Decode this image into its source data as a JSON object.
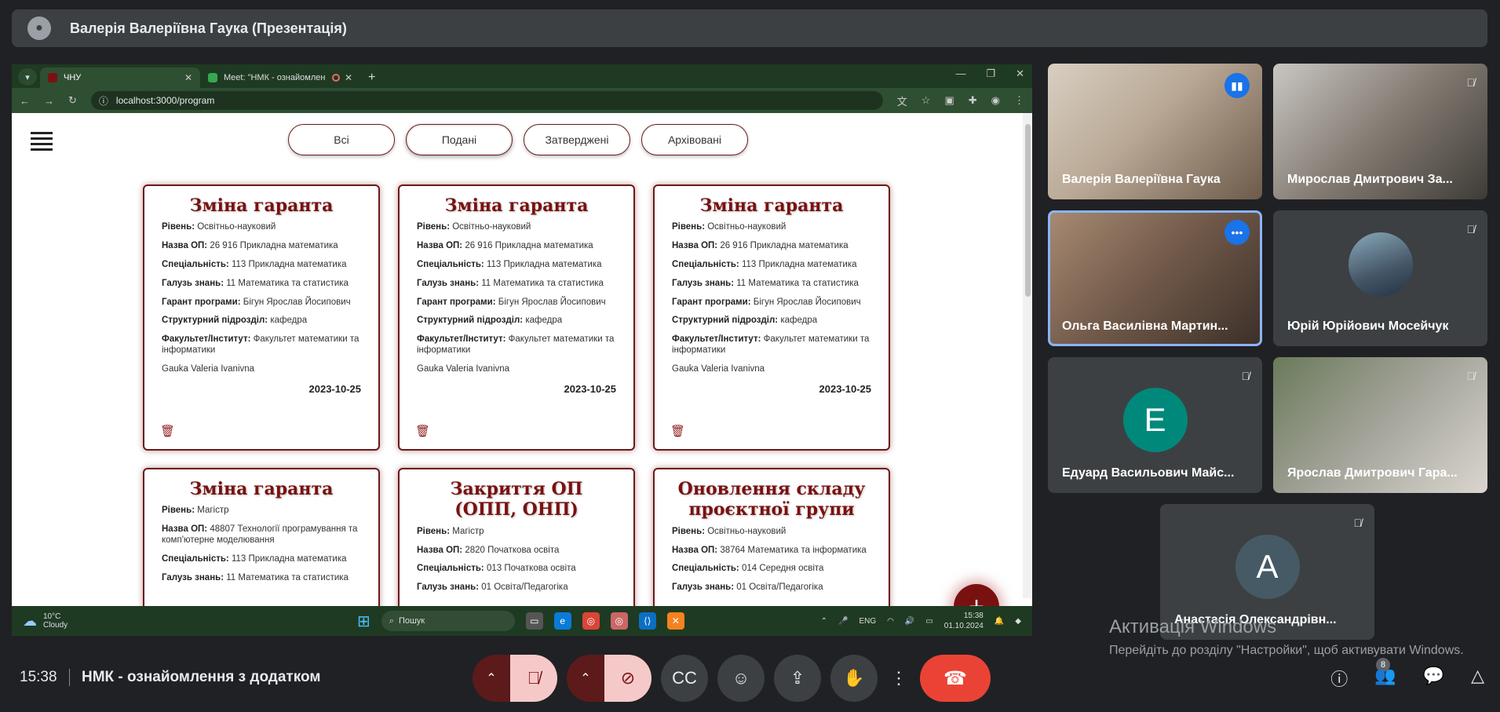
{
  "top": {
    "presenter_title": "Валерія Валеріївна Гаука (Презентація)"
  },
  "browser": {
    "tabs": [
      {
        "title": "ЧНУ"
      },
      {
        "title": "Meet: \"НМК - ознайомлен"
      }
    ],
    "url": "localhost:3000/program"
  },
  "filters": [
    "Всі",
    "Подані",
    "Затверджені",
    "Архівовані"
  ],
  "labels": {
    "level": "Рівень:",
    "op_name": "Назва ОП:",
    "specialty": "Спеціальність:",
    "field": "Галузь знань:",
    "guarantor": "Гарант програми:",
    "unit": "Структурний підрозділ:",
    "faculty": "Факультет/Інститут:"
  },
  "cards": [
    {
      "title": "Зміна гаранта",
      "level": "Освітньо-науковий",
      "op_name": "26 916 Прикладна математика",
      "specialty": "113 Прикладна математика",
      "field": "11 Математика та статистика",
      "guarantor": "Бігун Ярослав Йосипович",
      "unit": "кафедра",
      "faculty": "Факультет математики та інформатики",
      "author": "Gauka Valeria Ivanivna",
      "date": "2023-10-25"
    },
    {
      "title": "Зміна гаранта",
      "level": "Освітньо-науковий",
      "op_name": "26 916 Прикладна математика",
      "specialty": "113 Прикладна математика",
      "field": "11 Математика та статистика",
      "guarantor": "Бігун Ярослав Йосипович",
      "unit": "кафедра",
      "faculty": "Факультет математики та інформатики",
      "author": "Gauka Valeria Ivanivna",
      "date": "2023-10-25"
    },
    {
      "title": "Зміна гаранта",
      "level": "Освітньо-науковий",
      "op_name": "26 916 Прикладна математика",
      "specialty": "113 Прикладна математика",
      "field": "11 Математика та статистика",
      "guarantor": "Бігун Ярослав Йосипович",
      "unit": "кафедра",
      "faculty": "Факультет математики та інформатики",
      "author": "Gauka Valeria Ivanivna",
      "date": "2023-10-25"
    },
    {
      "title": "Зміна гаранта",
      "level": "Магістр",
      "op_name": "48807 Технології програмування та комп'ютерне моделювання",
      "specialty": "113 Прикладна математика",
      "field": "11 Математика та статистика"
    },
    {
      "title": "Закриття ОП (ОПП, ОНП)",
      "level": "Магістр",
      "op_name": "2820 Початкова освіта",
      "specialty": "013 Початкова освіта",
      "field": "01 Освіта/Педагогіка"
    },
    {
      "title": "Оновлення складу проєктної групи",
      "level": "Освітньо-науковий",
      "op_name": "38764 Математика та інформатика",
      "specialty": "014 Середня освіта",
      "field": "01 Освіта/Педагогіка"
    }
  ],
  "taskbar": {
    "temp": "10°C",
    "condition": "Cloudy",
    "search": "Пошук",
    "lang": "ENG",
    "time": "15:38",
    "date": "01.10.2024"
  },
  "participants": [
    {
      "name": "Валерія Валеріївна Гаука"
    },
    {
      "name": "Мирослав Дмитрович За..."
    },
    {
      "name": "Ольга Василівна Мартин..."
    },
    {
      "name": "Юрій Юрійович Мосейчук"
    },
    {
      "name": "Едуард Васильович Майс...",
      "initial": "Е"
    },
    {
      "name": "Ярослав Дмитрович Гара..."
    },
    {
      "name": "Анастасія Олександрівн...",
      "initial": "А"
    }
  ],
  "activation": {
    "title": "Активація Windows",
    "text": "Перейдіть до розділу \"Настройки\", щоб активувати Windows."
  },
  "bottom": {
    "time": "15:38",
    "meeting": "НМК - ознайомлення з додатком",
    "people_count": "8"
  },
  "colors": {
    "accent": "#7a1111",
    "meet_bg": "#202124",
    "end_call": "#ea4335"
  }
}
